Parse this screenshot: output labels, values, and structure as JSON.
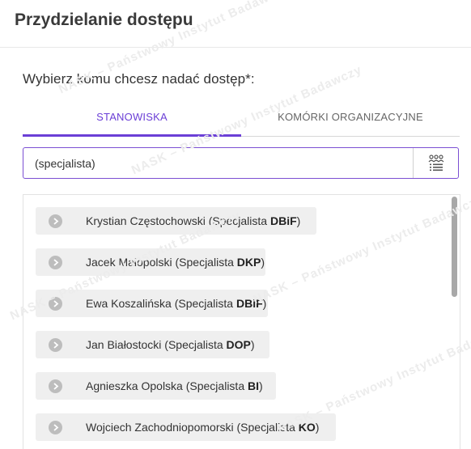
{
  "dialog": {
    "title": "Przydzielanie dostępu",
    "prompt": "Wybierz komu chcesz nadać dostęp*:"
  },
  "tabs": [
    {
      "label": "STANOWISKA",
      "active": true
    },
    {
      "label": "KOMÓRKI ORGANIZACYJNE",
      "active": false
    }
  ],
  "search": {
    "value": "(specjalista)",
    "button_icon": "people-list-icon"
  },
  "results": [
    {
      "name": "Krystian Częstochowski",
      "prefix": " (Specjalista ",
      "unit": "DBiF",
      "suffix": ")"
    },
    {
      "name": "Jacek Małopolski",
      "prefix": " (Specjalista ",
      "unit": "DKP",
      "suffix": ")"
    },
    {
      "name": "Ewa Koszalińska",
      "prefix": " (Specjalista ",
      "unit": "DBiF",
      "suffix": ")"
    },
    {
      "name": "Jan Białostocki",
      "prefix": " (Specjalista ",
      "unit": "DOP",
      "suffix": ")"
    },
    {
      "name": "Agnieszka Opolska",
      "prefix": " (Specjalista ",
      "unit": "BI",
      "suffix": ")"
    },
    {
      "name": "Wojciech Zachodniopomorski",
      "prefix": " (Specjalista ",
      "unit": "KO",
      "suffix": ")"
    }
  ],
  "watermark": {
    "text": "NASK – Państwowy Instytut Badawczy",
    "logo": "EZD"
  },
  "colors": {
    "accent": "#6b3fd6",
    "item_bg": "#efefef",
    "chevron_bg": "#bdbdbd"
  }
}
